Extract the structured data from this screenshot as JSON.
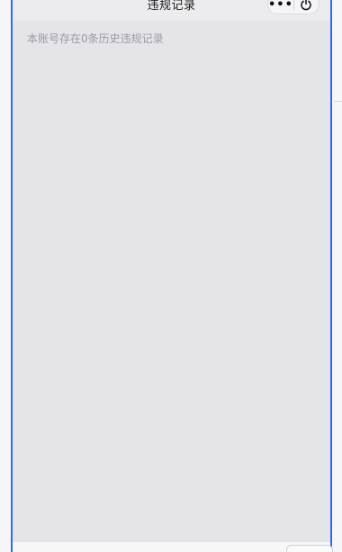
{
  "nav": {
    "title": "违规记录",
    "more_icon": "more-dots-icon",
    "exit_icon": "power-icon"
  },
  "main": {
    "notice": "本账号存在0条历史违规记录"
  },
  "colors": {
    "frame_border": "#2f6bef",
    "content_bg": "#e5e4e9",
    "notice_text": "#9a9aa0"
  }
}
